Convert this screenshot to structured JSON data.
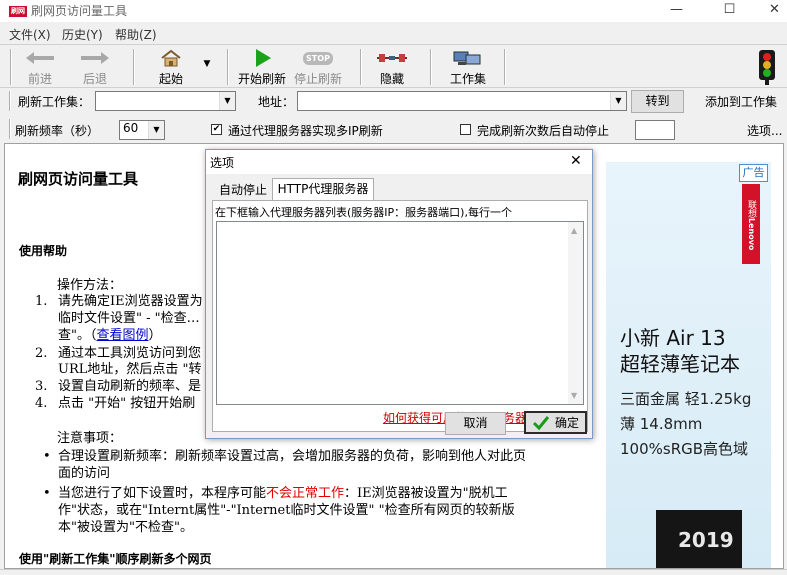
{
  "window": {
    "title": "刷网页访问量工具",
    "icon_text": "刷网",
    "controls": [
      "—",
      "☐",
      "✕"
    ]
  },
  "menu": [
    "文件(X)",
    "历史(Y)",
    "帮助(Z)"
  ],
  "toolbar": {
    "back": "前进",
    "forward": "后退",
    "start": "起始",
    "start_refresh": "开始刷新",
    "stop_refresh": "停止刷新",
    "stop_icon_text": "STOP",
    "hide": "隐藏",
    "workset": "工作集"
  },
  "row1": {
    "workset_label": "刷新工作集：",
    "workset_value": "",
    "address_label": "地址：",
    "address_value": "",
    "goto_button": "转到",
    "add_button": "添加到工作集"
  },
  "row2": {
    "freq_label": "刷新频率（秒）",
    "freq_value": "60",
    "proxy_checkbox_label": "通过代理服务器实现多IP刷新",
    "proxy_checked": true,
    "autostop_label": "完成刷新次数后自动停止",
    "autostop_checked": false,
    "autostop_value": "",
    "options_button": "选项..."
  },
  "doc": {
    "title": "刷网页访问量工具",
    "help_heading": "使用帮助",
    "method_label": "操作方法：",
    "steps": [
      {
        "num": "1.",
        "line1": "请先确定IE浏览器设置为",
        "line2": "临时文件设置\" - \"检查…",
        "line3_pre": "查\"。（",
        "line3_link": "查看图例",
        "line3_post": "）"
      },
      {
        "num": "2.",
        "line1": "通过本工具浏览访问到您",
        "line2": "URL地址，然后点击 \"转"
      },
      {
        "num": "3.",
        "line1": "设置自动刷新的频率、是"
      },
      {
        "num": "4.",
        "line1": "点击 \"开始\" 按钮开始刷"
      }
    ],
    "notes_label": "注意事项：",
    "note1": "合理设置刷新频率：刷新频率设置过高，会增加服务器的负荷，影响到他人对此页面的访问",
    "note2_pre": "当您进行了如下设置时，本程序可能",
    "note2_red": "不会正常工作",
    "note2_post": "：IE浏览器被设置为\"脱机工作\"状态，或在\"Internt属性\"-\"Internet临时文件设置\" \"检查所有网页的较新版本\"被设置为\"不检查\"。",
    "workset_heading": "使用\"刷新工作集\"顺序刷新多个网页"
  },
  "ad": {
    "badge": "广告",
    "brand_cn": "联想",
    "brand_en": "Lenovo",
    "headline1": "小新 Air 13",
    "headline2": "超轻薄笔记本",
    "spec1": "三面金属 轻1.25kg",
    "spec2": "薄 14.8mm",
    "spec3": "100%sRGB高色域",
    "promo_year": "2019"
  },
  "dialog": {
    "title": "选项",
    "tabs": [
      "自动停止",
      "HTTP代理服务器"
    ],
    "active_tab": 1,
    "instruction": "在下框输入代理服务器列表(服务器IP：服务器端口),每行一个",
    "proxy_list": "",
    "help_link": "如何获得可用的代理服务器列表？",
    "cancel": "取消",
    "ok": "确定"
  },
  "colors": {
    "accent_red": "#cc0000",
    "link_blue": "#0000cc",
    "ad_brand_red": "#d3122a"
  }
}
